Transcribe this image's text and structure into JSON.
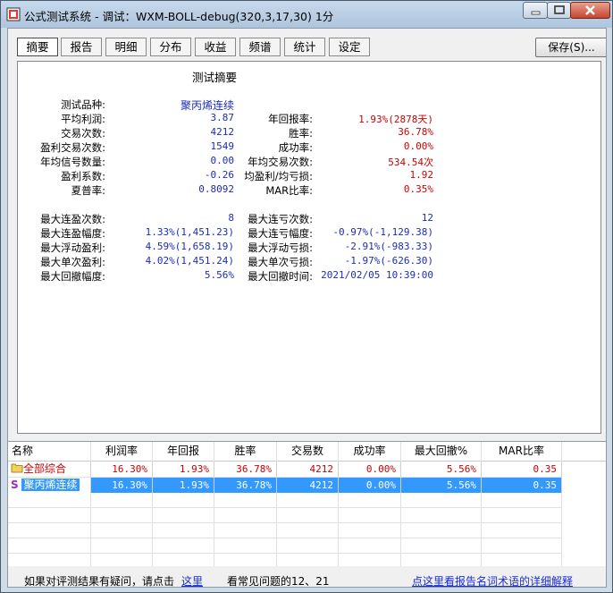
{
  "window": {
    "title": "公式测试系统 - 调试：WXM-BOLL-debug(320,3,17,30) 1分"
  },
  "tabs": [
    {
      "label": "摘要",
      "active": true
    },
    {
      "label": "报告"
    },
    {
      "label": "明细"
    },
    {
      "label": "分布"
    },
    {
      "label": "收益"
    },
    {
      "label": "频谱"
    },
    {
      "label": "统计"
    },
    {
      "label": "设定"
    }
  ],
  "save_button": "保存(S)...",
  "summary": {
    "title": "测试摘要",
    "left_group_1": [
      {
        "label": "测试品种:",
        "value": "聚丙烯连续"
      },
      {
        "label": "平均利润:",
        "value": "3.87"
      },
      {
        "label": "交易次数:",
        "value": "4212"
      },
      {
        "label": "盈利交易次数:",
        "value": "1549"
      },
      {
        "label": "年均信号数量:",
        "value": "0.00"
      },
      {
        "label": "盈利系数:",
        "value": "-0.26"
      },
      {
        "label": "夏普率:",
        "value": "0.8092"
      }
    ],
    "right_group_1": [
      {
        "label": "年回报率:",
        "value": "1.93%(2878天)"
      },
      {
        "label": "胜率:",
        "value": "36.78%"
      },
      {
        "label": "成功率:",
        "value": "0.00%"
      },
      {
        "label": "年均交易次数:",
        "value": "534.54次"
      },
      {
        "label": "均盈利/均亏损:",
        "value": "1.92"
      },
      {
        "label": "MAR比率:",
        "value": "0.35%"
      }
    ],
    "left_group_2": [
      {
        "label": "最大连盈次数:",
        "value": "8"
      },
      {
        "label": "最大连盈幅度:",
        "value": "1.33%(1,451.23)"
      },
      {
        "label": "最大浮动盈利:",
        "value": "4.59%(1,658.19)"
      },
      {
        "label": "最大单次盈利:",
        "value": "4.02%(1,451.24)"
      },
      {
        "label": "最大回撤幅度:",
        "value": "5.56%"
      }
    ],
    "right_group_2": [
      {
        "label": "最大连亏次数:",
        "value": "12"
      },
      {
        "label": "最大连亏幅度:",
        "value": "-0.97%(-1,129.38)"
      },
      {
        "label": "最大浮动亏损:",
        "value": "-2.91%(-983.33)"
      },
      {
        "label": "最大单次亏损:",
        "value": "-1.97%(-626.30)"
      },
      {
        "label": "最大回撤时间:",
        "value": "2021/02/05 10:39:00"
      }
    ]
  },
  "table": {
    "columns": [
      "名称",
      "利润率",
      "年回报",
      "胜率",
      "交易数",
      "成功率",
      "最大回撤%",
      "MAR比率"
    ],
    "rows": [
      {
        "icon": "folder-icon",
        "cells": [
          "全部综合",
          "16.30%",
          "1.93%",
          "36.78%",
          "4212",
          "0.00%",
          "5.56%",
          "0.35"
        ],
        "selected": false
      },
      {
        "icon": "S",
        "cells": [
          "聚丙烯连续",
          "16.30%",
          "1.93%",
          "36.78%",
          "4212",
          "0.00%",
          "5.56%",
          "0.35"
        ],
        "selected": true
      }
    ]
  },
  "status": {
    "question_text": "如果对评测结果有疑问，请点击",
    "question_link": "这里",
    "faq_text": "看常见问题的12、21",
    "glossary_link": "点这里看报告名词术语的详细解释"
  },
  "colors": {
    "selected_row": "#3399ff",
    "value_blue": "#1c2cb8",
    "value_red": "#cc0000"
  }
}
